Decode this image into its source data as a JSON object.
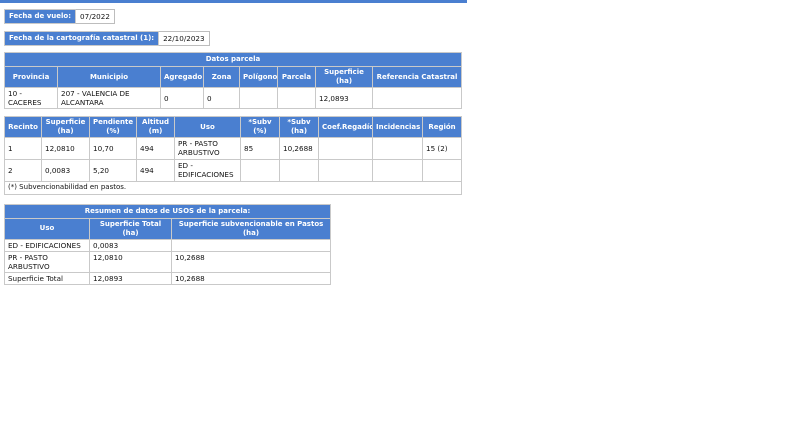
{
  "header_fields": {
    "fecha_vuelo_label": "Fecha de vuelo:",
    "fecha_vuelo_value": "07/2022",
    "fecha_cartografia_label": "Fecha de la cartografía catastral (1):",
    "fecha_cartografia_value": "22/10/2023"
  },
  "parcela": {
    "title": "Datos parcela",
    "headers": [
      "Provincia",
      "Municipio",
      "Agregado",
      "Zona",
      "Polígono",
      "Parcela",
      "Superficie (ha)",
      "Referencia Catastral"
    ],
    "row": [
      "10 - CACERES",
      "207 - VALENCIA DE ALCANTARA",
      "0",
      "0",
      "",
      "",
      "12,0893",
      ""
    ]
  },
  "recintos": {
    "headers": [
      "Recinto",
      "Superficie (ha)",
      "Pendiente (%)",
      "Altitud (m)",
      "Uso",
      "*Subv (%)",
      "*Subv (ha)",
      "Coef.Regadío",
      "Incidencias",
      "Región"
    ],
    "rows": [
      [
        "1",
        "12,0810",
        "10,70",
        "494",
        "PR - PASTO ARBUSTIVO",
        "85",
        "10,2688",
        "",
        "",
        "15 (2)"
      ],
      [
        "2",
        "0,0083",
        "5,20",
        "494",
        "ED - EDIFICACIONES",
        "",
        "",
        "",
        "",
        ""
      ]
    ],
    "note": "(*) Subvencionabilidad en pastos."
  },
  "resumen": {
    "title": "Resumen de datos de USOS de la parcela:",
    "headers": [
      "Uso",
      "Superficie Total (ha)",
      "Superficie subvencionable en Pastos (ha)"
    ],
    "rows": [
      [
        "ED - EDIFICACIONES",
        "0,0083",
        ""
      ],
      [
        "PR - PASTO ARBUSTIVO",
        "12,0810",
        "10,2688"
      ],
      [
        "Superficie Total",
        "12,0893",
        "10,2688"
      ]
    ]
  },
  "colors": {
    "header_bg": "#4a7fd0",
    "header_text": "#ffffff",
    "border": "#c9c9c9"
  }
}
